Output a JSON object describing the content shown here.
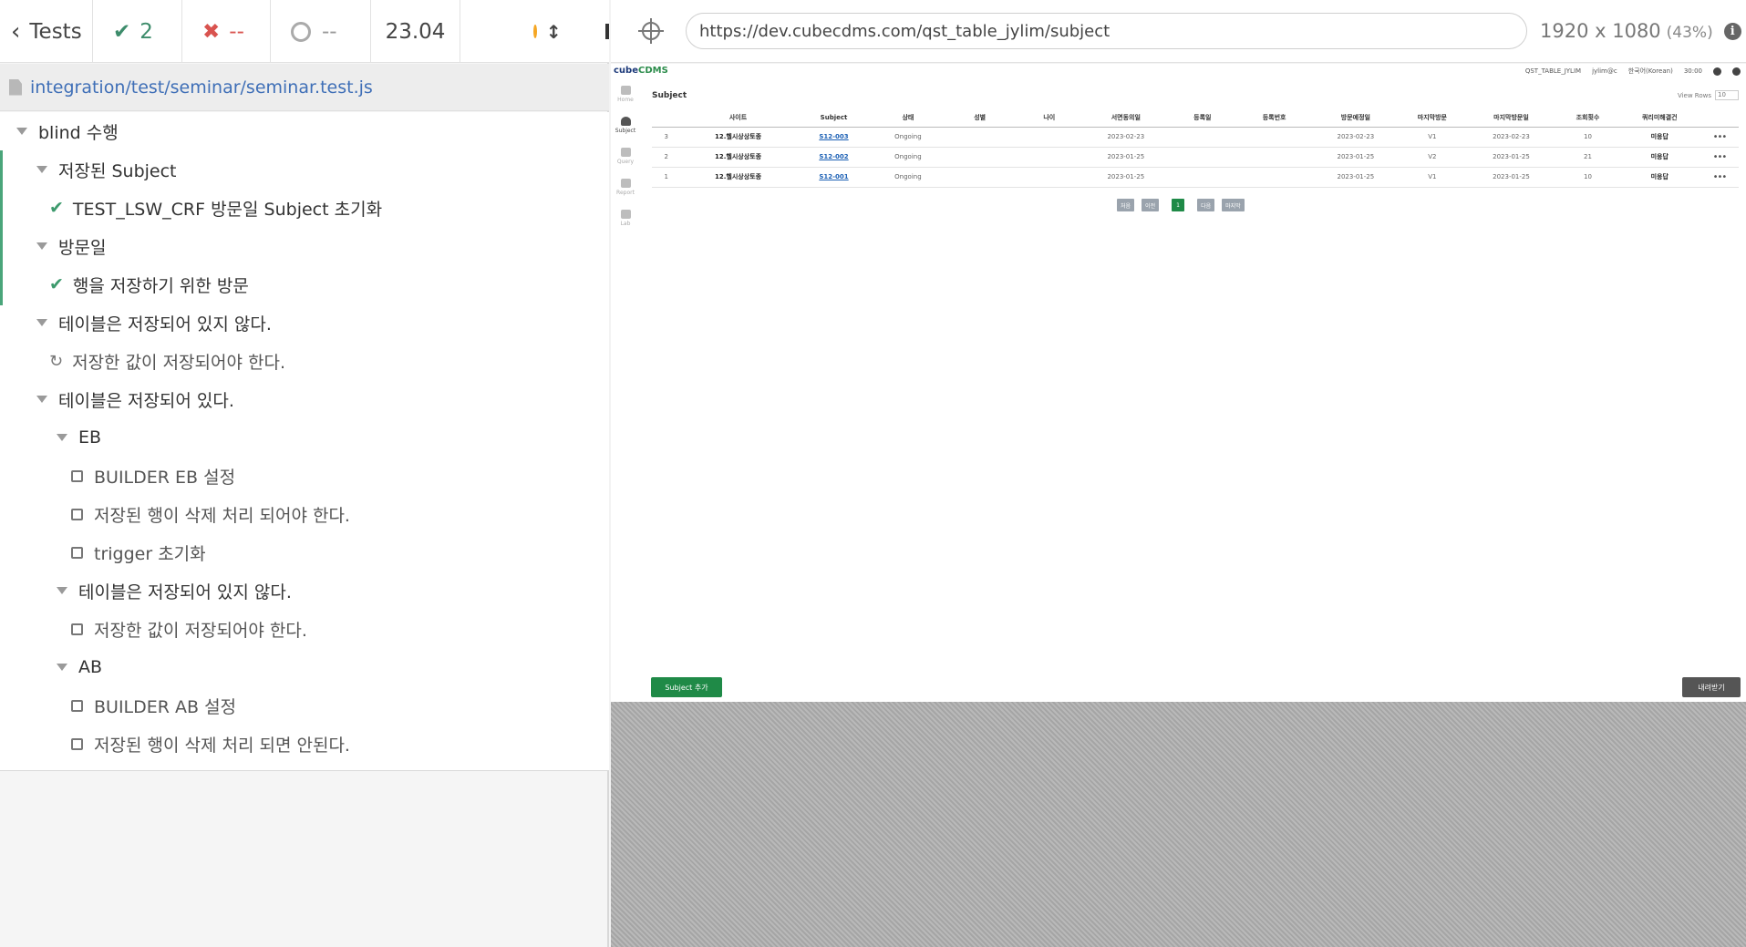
{
  "reporter": {
    "back_label": "Tests",
    "passed": "2",
    "failed": "--",
    "pending": "--",
    "duration": "23.04"
  },
  "spec_file": "integration/test/seminar/seminar.test.js",
  "tree": [
    {
      "label": "blind 수행"
    },
    {
      "label": "저장된 Subject"
    },
    {
      "label": "TEST_LSW_CRF 방문일 Subject 초기화"
    },
    {
      "label": "방문일"
    },
    {
      "label": "행을 저장하기 위한 방문"
    },
    {
      "label": "테이블은 저장되어 있지 않다."
    },
    {
      "label": "저장한 값이 저장되어야 한다."
    },
    {
      "label": "테이블은 저장되어 있다."
    },
    {
      "label": "EB"
    },
    {
      "label": "BUILDER EB 설정"
    },
    {
      "label": "저장된 행이 삭제 처리 되어야 한다."
    },
    {
      "label": "trigger 초기화"
    },
    {
      "label": "테이블은 저장되어 있지 않다."
    },
    {
      "label": "저장한 값이 저장되어야 한다."
    },
    {
      "label": "AB"
    },
    {
      "label": "BUILDER AB 설정"
    },
    {
      "label": "저장된 행이 삭제 처리 되면 안된다."
    }
  ],
  "browser": {
    "url": "https://dev.cubecdms.com/qst_table_jylim/subject",
    "viewport": "1920 x 1080",
    "scale": "(43%)"
  },
  "app": {
    "logo_a": "cube",
    "logo_b": "CDMS",
    "top_study": "QST_TABLE_JYLIM",
    "top_user": "jylim@c",
    "top_lang": "한국어(Korean)",
    "top_time": "30:00",
    "nav": [
      "Home",
      "Subject",
      "Query",
      "Report",
      "Lab"
    ],
    "title": "Subject",
    "view_rows_label": "View Rows",
    "view_rows_value": "10",
    "columns": [
      "",
      "사이트",
      "Subject",
      "상태",
      "성별",
      "나이",
      "서면동의일",
      "등록일",
      "등록번호",
      "방문예정일",
      "마지막방문",
      "마지막방문일",
      "조회횟수",
      "쿼리미해결건",
      ""
    ],
    "rows": [
      [
        "3",
        "12.헬시상상토종",
        "S12-003",
        "Ongoing",
        "",
        "",
        "2023-02-23",
        "",
        "",
        "2023-02-23",
        "V1",
        "2023-02-23",
        "10",
        "미응답",
        "•••"
      ],
      [
        "2",
        "12.헬시상상토종",
        "S12-002",
        "Ongoing",
        "",
        "",
        "2023-01-25",
        "",
        "",
        "2023-01-25",
        "V2",
        "2023-01-25",
        "21",
        "미응답",
        "•••"
      ],
      [
        "1",
        "12.헬시상상토종",
        "S12-001",
        "Ongoing",
        "",
        "",
        "2023-01-25",
        "",
        "",
        "2023-01-25",
        "V1",
        "2023-01-25",
        "10",
        "미응답",
        "•••"
      ]
    ],
    "pager": [
      "처음",
      "이전",
      "1",
      "다음",
      "마지막"
    ],
    "add_button": "Subject 추가",
    "export_button": "내려받기"
  }
}
